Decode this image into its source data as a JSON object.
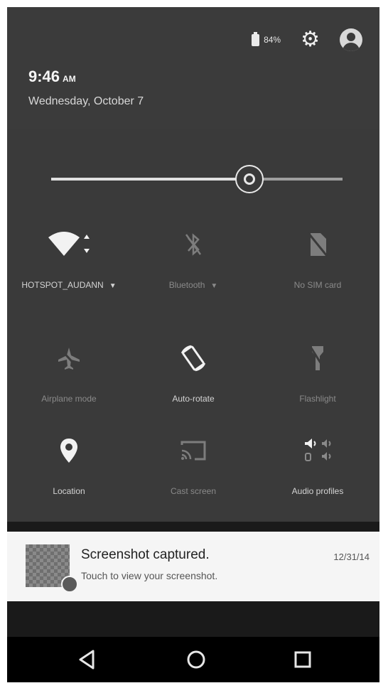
{
  "status": {
    "battery_text": "84%"
  },
  "header": {
    "time": "9:46",
    "ampm": "AM",
    "date": "Wednesday, October 7"
  },
  "brightness": {
    "level": 0.68
  },
  "tiles": [
    {
      "label": "HOTSPOT_AUDANN",
      "icon": "wifi-icon",
      "dropdown": true
    },
    {
      "label": "Bluetooth",
      "icon": "bluetooth-off-icon",
      "dropdown": true
    },
    {
      "label": "No SIM card",
      "icon": "no-sim-icon",
      "dropdown": false
    },
    {
      "label": "Airplane mode",
      "icon": "airplane-off-icon",
      "dropdown": false
    },
    {
      "label": "Auto-rotate",
      "icon": "auto-rotate-icon",
      "dropdown": false
    },
    {
      "label": "Flashlight",
      "icon": "flashlight-off-icon",
      "dropdown": false
    },
    {
      "label": "Location",
      "icon": "location-pin-icon",
      "dropdown": false
    },
    {
      "label": "Cast screen",
      "icon": "cast-icon",
      "dropdown": false
    },
    {
      "label": "Audio profiles",
      "icon": "audio-profiles-icon",
      "dropdown": false
    }
  ],
  "notification": {
    "title": "Screenshot captured.",
    "text": "Touch to view your screenshot.",
    "date": "12/31/14"
  },
  "navbar": {
    "back": "back-icon",
    "home": "home-icon",
    "recents": "recents-icon"
  }
}
